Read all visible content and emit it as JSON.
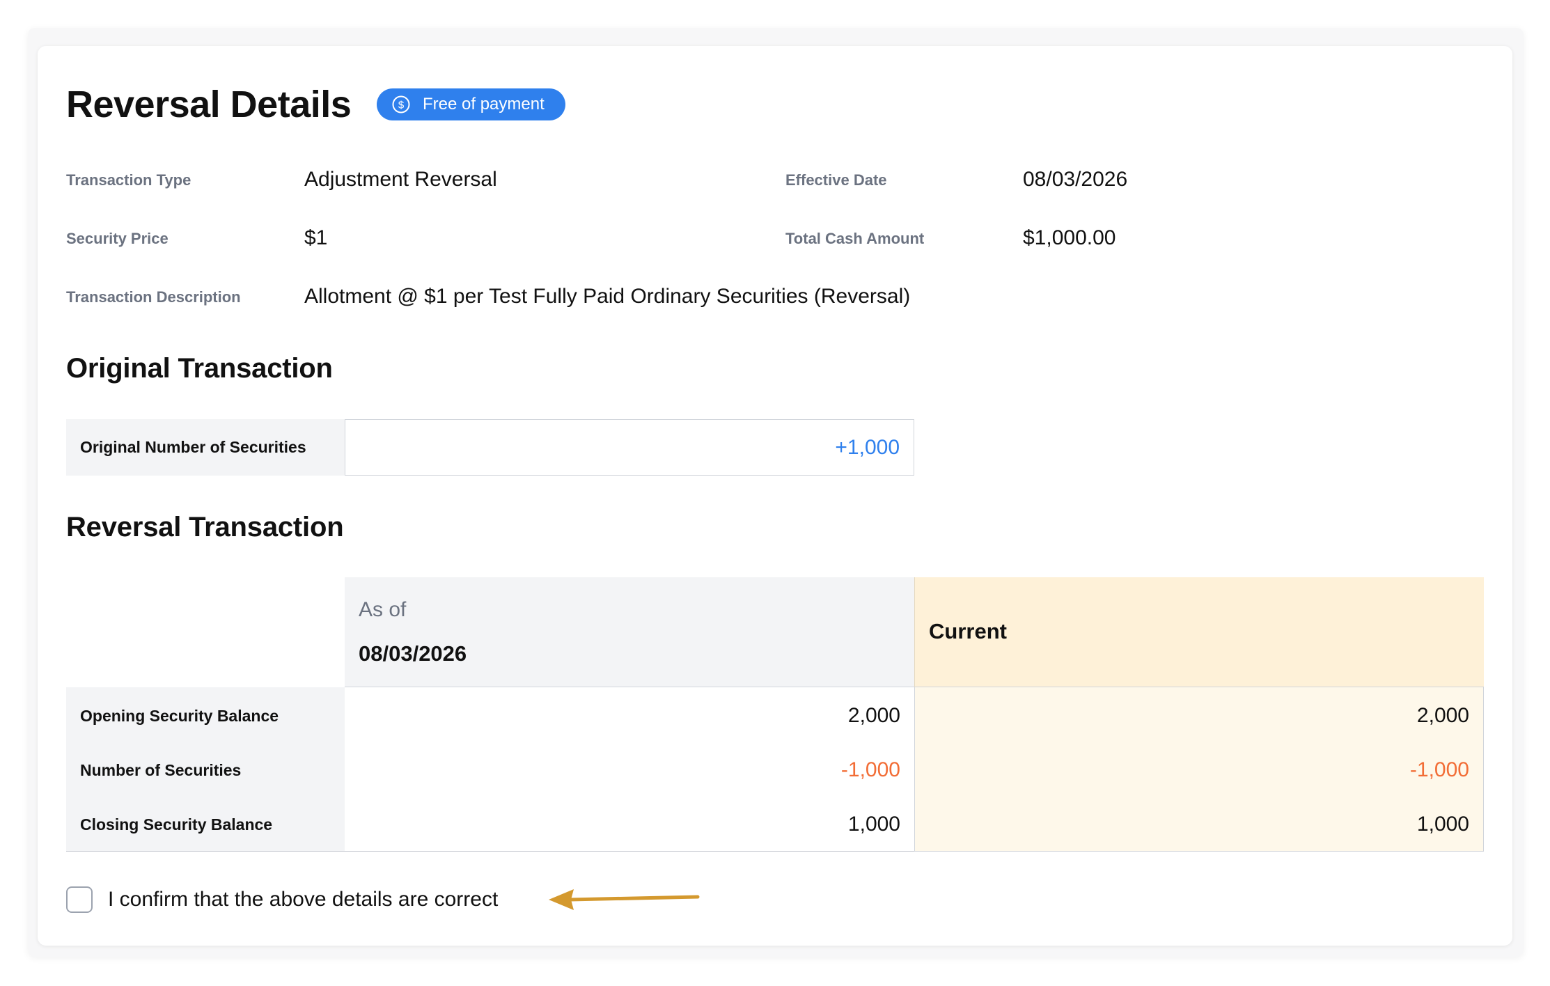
{
  "header": {
    "title": "Reversal Details",
    "badge_label": "Free of payment",
    "badge_icon": "dollar-coin-icon",
    "badge_color": "#2f80ed"
  },
  "details": {
    "transaction_type_label": "Transaction Type",
    "transaction_type_value": "Adjustment Reversal",
    "effective_date_label": "Effective Date",
    "effective_date_value": "08/03/2026",
    "security_price_label": "Security Price",
    "security_price_value": "$1",
    "total_cash_label": "Total Cash Amount",
    "total_cash_value": "$1,000.00",
    "description_label": "Transaction Description",
    "description_value": "Allotment @ $1 per Test Fully Paid Ordinary Securities (Reversal)"
  },
  "original": {
    "heading": "Original Transaction",
    "row_label": "Original Number of Securities",
    "row_value": "+1,000"
  },
  "reversal": {
    "heading": "Reversal Transaction",
    "asof_label": "As of",
    "asof_date": "08/03/2026",
    "current_label": "Current",
    "rows": [
      {
        "label": "Opening Security Balance",
        "asof": "2,000",
        "current": "2,000"
      },
      {
        "label": "Number of Securities",
        "asof": "-1,000",
        "current": "-1,000"
      },
      {
        "label": "Closing Security Balance",
        "asof": "1,000",
        "current": "1,000"
      }
    ]
  },
  "confirm": {
    "label": "I confirm that the above details are correct",
    "checked": false
  },
  "colors": {
    "positive": "#2f80ed",
    "negative": "#f26d36",
    "current_header_bg": "#fef1d8",
    "arrow": "#d4992e"
  }
}
